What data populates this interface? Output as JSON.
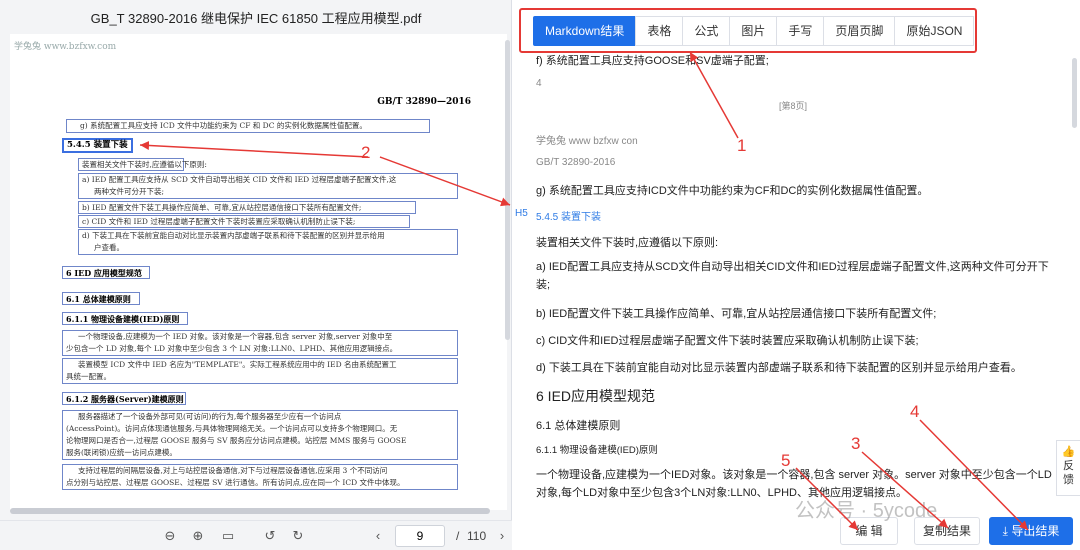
{
  "pdf": {
    "title": "GB_T 32890-2016 继电保护 IEC 61850 工程应用模型.pdf",
    "watermark": "学兔兔 www.bzfxw.com",
    "std_number": "GB/T 32890—2016",
    "line_g": "g) 系统配置工具应支持 ICD 文件中功能约束为 CF 和 DC 的实例化数据属性值配置。",
    "heading_545": "5.4.5 装置下装",
    "para_intro": "装置相关文件下装时,应遵循以下原则:",
    "item_a1": "a) IED 配置工具应支持从 SCD 文件自动导出相关 CID 文件和 IED 过程层虚端子配置文件,这",
    "item_a2": "两种文件可分开下装;",
    "item_b": "b) IED 配置文件下装工具操作应简单、可靠,宜从站控层通信接口下装所有配置文件;",
    "item_c": "c) CID 文件和 IED 过程层虚端子配置文件下装时装置应采取确认机制防止误下装;",
    "item_d1": "d) 下装工具在下装前宜能自动对比显示装置内部虚端子联系和待下装配置的区别并显示给用",
    "item_d2": "户查看。",
    "heading_6": "6 IED 应用模型规范",
    "heading_61": "6.1 总体建模原则",
    "heading_611": "6.1.1 物理设备建模(IED)原则",
    "p611_1": "一个物理设备,应建模为一个 IED 对象。该对象是一个容器,包含 server 对象,server 对象中至",
    "p611_2": "少包含一个 LD 对象,每个 LD 对象中至少包含 3 个 LN 对象:LLN0、LPHD、其他应用逻辑接点。",
    "p611_3": "装置模型 ICD 文件中 IED 名应为\"TEMPLATE\"。实际工程系统应用中的 IED 名由系统配置工",
    "p611_4": "具统一配置。",
    "heading_612": "6.1.2 服务器(Server)建模原则",
    "p612_1": "服务器描述了一个设备外部可见(可访问)的行为,每个服务器至少应有一个访问点",
    "p612_2": "(AccessPoint)。访问点体现通信服务,与具体物理网络无关。一个访问点可以支持多个物理网口。无",
    "p612_3": "论物理网口是否合一,过程层 GOOSE 服务与 SV 服务应分访问点建模。站控层 MMS 服务与 GOOSE",
    "p612_4": "服务(联闭锁)应统一访问点建模。",
    "p612_5": "支持过程层的间隔层设备,对上与站控层设备通信,对下与过程层设备通信,应采用 3 个不同访问",
    "p612_6": "点分别与站控层、过程层 GOOSE、过程层 SV 进行通信。所有访问点,应在同一个 ICD 文件中体现。"
  },
  "toolbar": {
    "page_current": "9",
    "page_sep": "/",
    "page_total": "110",
    "icons": [
      "zoom-out-icon",
      "zoom-in-icon",
      "fit-page-icon",
      "rotate-left-icon",
      "rotate-right-icon",
      "prev-page-icon",
      "next-page-icon"
    ]
  },
  "tabs": [
    "Markdown结果",
    "表格",
    "公式",
    "图片",
    "手写",
    "页眉页脚",
    "原始JSON"
  ],
  "result": {
    "line_f": "f) 系统配置工具应支持GOOSE和SV虚端子配置;",
    "line_4": "4",
    "page_marker": "[第8页]",
    "watermark": "学兔兔 www bzfxw con",
    "std": "GB/T 32890-2016",
    "line_g": "g) 系统配置工具应支持ICD文件中功能约束为CF和DC的实例化数据属性值配置。",
    "h5": "H5",
    "heading_545": "5.4.5 装置下装",
    "intro": "装置相关文件下装时,应遵循以下原则:",
    "item_a": "a) IED配置工具应支持从SCD文件自动导出相关CID文件和IED过程层虚端子配置文件,这两种文件可分开下装;",
    "item_b": "b) IED配置文件下装工具操作应简单、可靠,宜从站控层通信接口下装所有配置文件;",
    "item_c": "c) CID文件和IED过程层虚端子配置文件下装时装置应采取确认机制防止误下装;",
    "item_d": "d) 下装工具在下装前宜能自动对比显示装置内部虚端子联系和待下装配置的区别并显示给用户查看。",
    "heading_6": "6 IED应用模型规范",
    "heading_61": "6.1 总体建模原则",
    "heading_611": "6.1.1 物理设备建模(IED)原则",
    "para": "一个物理设备,应建模为一个IED对象。该对象是一个容器,包含 server 对象。server 对象中至少包含一个LD对象,每个LD对象中至少包含3个LN对象:LLN0、LPHD、其他应用逻辑接点。"
  },
  "actions": {
    "edit": "编 辑",
    "copy": "复制结果",
    "export": "导出结果",
    "feedback": "反馈"
  },
  "annotations": [
    "1",
    "2",
    "3",
    "4",
    "5"
  ],
  "brand_watermark": "公众号 · 5ycode",
  "colors": {
    "accent": "#1e6fe8",
    "annotation": "#e53935"
  }
}
